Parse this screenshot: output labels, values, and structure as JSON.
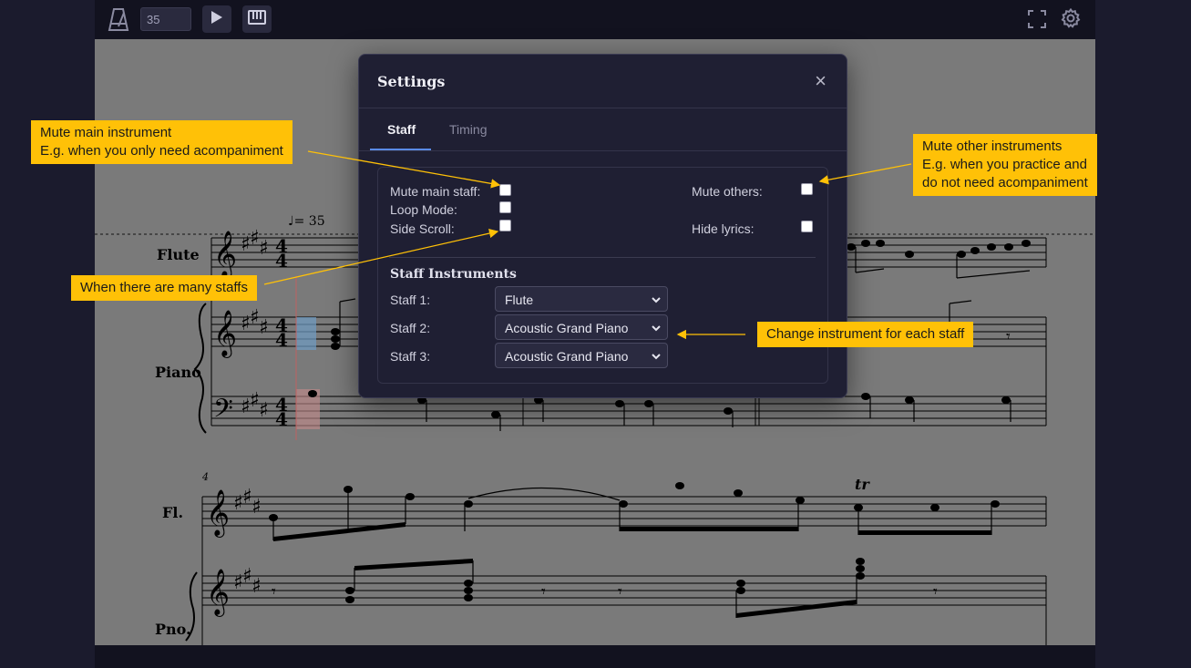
{
  "toolbar": {
    "tempo_value": "35",
    "icons": [
      "metronome-icon",
      "play-icon",
      "piano-icon",
      "fullscreen-icon",
      "gear-icon"
    ]
  },
  "score": {
    "tempo_mark": "= 35",
    "staves": [
      "Flute",
      "Piano",
      "Fl.",
      "Pno."
    ],
    "measure_number": "4",
    "trill": "tr"
  },
  "settings": {
    "title": "Settings",
    "close": "×",
    "tabs": [
      {
        "label": "Staff",
        "active": true
      },
      {
        "label": "Timing",
        "active": false
      }
    ],
    "options": {
      "mute_main_staff": "Mute main staff:",
      "loop_mode": "Loop Mode:",
      "side_scroll": "Side Scroll:",
      "mute_others": "Mute others:",
      "hide_lyrics": "Hide lyrics:"
    },
    "section_title": "Staff Instruments",
    "staffs": [
      {
        "label": "Staff 1:",
        "value": "Flute"
      },
      {
        "label": "Staff 2:",
        "value": "Acoustic Grand Piano"
      },
      {
        "label": "Staff 3:",
        "value": "Acoustic Grand Piano"
      }
    ]
  },
  "callouts": {
    "mute_main": [
      "Mute main instrument",
      "E.g. when you only need acompaniment"
    ],
    "mute_others": [
      "Mute other instruments",
      "E.g. when you practice and",
      "do not need acompaniment"
    ],
    "many_staffs": "When there are many staffs",
    "change_instrument": "Change instrument for each staff"
  },
  "colors": {
    "callout": "#ffc107",
    "accent": "#5a8ae6",
    "modal_bg": "#1f1f33"
  }
}
